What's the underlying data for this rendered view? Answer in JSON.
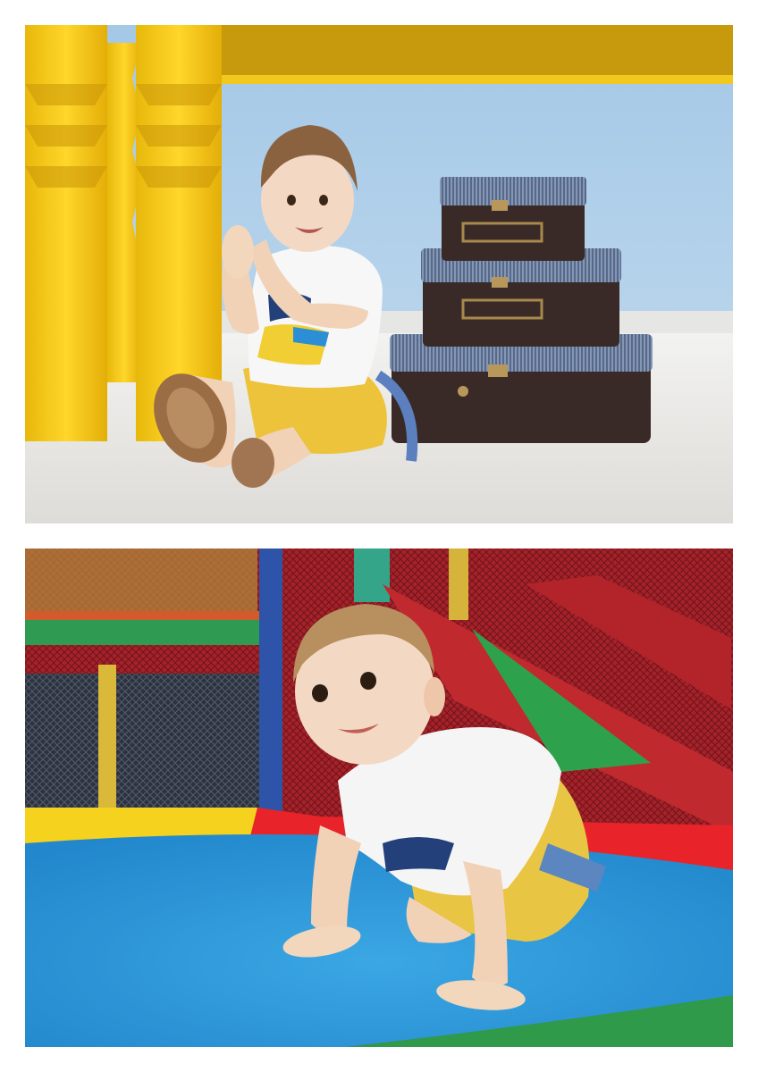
{
  "page": {
    "background": "#ffffff"
  },
  "photos": [
    {
      "id": "top",
      "scene": "toddler-sitting-by-yellow-columns-and-stacked-suitcases",
      "colors": {
        "wall": "#a9cbe6",
        "floor": "#ecebe8",
        "columns": "#f5c714",
        "suitcase": "#3a2a27",
        "suitcase_lid": "#4e6380",
        "shirt": "#f7f7f7",
        "shorts": "#ecc33a"
      }
    },
    {
      "id": "bottom",
      "scene": "toddler-crawling-on-blue-trampoline-in-playground",
      "colors": {
        "mat": "#2e9ad9",
        "net": "#b4282c",
        "green": "#2f9a4a",
        "yellow": "#f4d21d",
        "shirt": "#f5f5f5",
        "shorts": "#e9c544"
      }
    }
  ]
}
